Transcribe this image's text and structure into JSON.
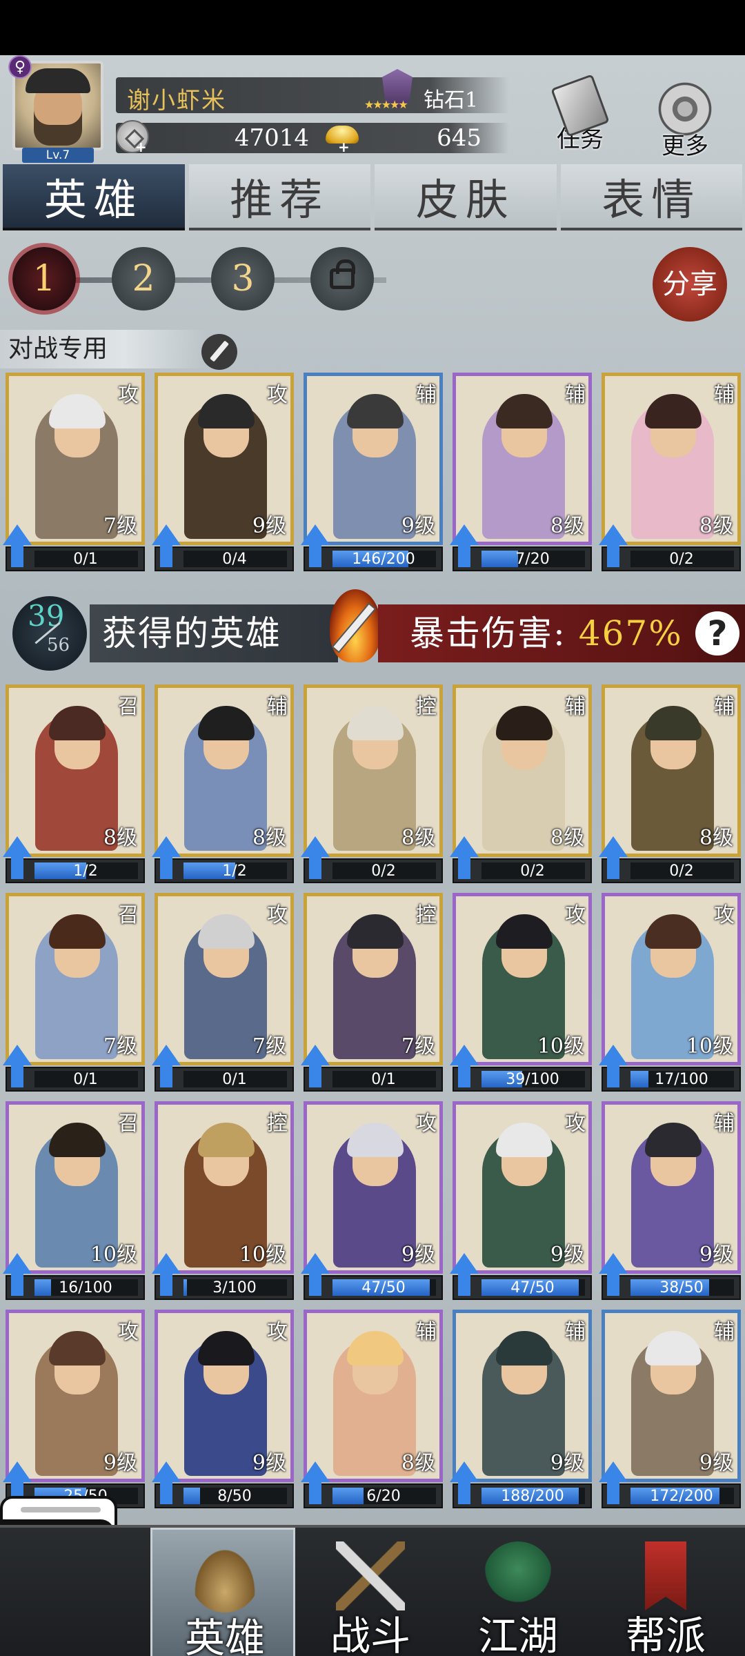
{
  "player": {
    "name": "谢小虾米",
    "level": "Lv.7",
    "gender": "♀",
    "rank": "钻石1",
    "silver": "47014",
    "gold": "645"
  },
  "top_buttons": {
    "task": "任务",
    "more": "更多"
  },
  "tabs": [
    "英雄",
    "推荐",
    "皮肤",
    "表情"
  ],
  "pages": [
    "1",
    "2",
    "3"
  ],
  "share": "分享",
  "lineup": {
    "label": "对战专用",
    "cards": [
      {
        "type": "攻",
        "level": "7级",
        "progress": "0/1",
        "fill": 0.0,
        "frame": "gold"
      },
      {
        "type": "攻",
        "level": "9级",
        "progress": "0/4",
        "fill": 0.0,
        "frame": "gold"
      },
      {
        "type": "辅",
        "level": "9级",
        "progress": "146/200",
        "fill": 0.73,
        "frame": "blue"
      },
      {
        "type": "辅",
        "level": "8级",
        "progress": "7/20",
        "fill": 0.35,
        "frame": "purple"
      },
      {
        "type": "辅",
        "level": "8级",
        "progress": "0/2",
        "fill": 0.0,
        "frame": "gold"
      }
    ]
  },
  "owned": {
    "count": "39",
    "total": "56",
    "label": "获得的英雄",
    "crit_label": "暴击伤害:",
    "crit_value": "467%",
    "help": "?"
  },
  "heroes": [
    [
      {
        "type": "召",
        "level": "8级",
        "progress": "1/2",
        "fill": 0.5,
        "frame": "gold"
      },
      {
        "type": "辅",
        "level": "8级",
        "progress": "1/2",
        "fill": 0.5,
        "frame": "gold"
      },
      {
        "type": "控",
        "level": "8级",
        "progress": "0/2",
        "fill": 0.0,
        "frame": "gold"
      },
      {
        "type": "辅",
        "level": "8级",
        "progress": "0/2",
        "fill": 0.0,
        "frame": "gold"
      },
      {
        "type": "辅",
        "level": "8级",
        "progress": "0/2",
        "fill": 0.0,
        "frame": "gold"
      }
    ],
    [
      {
        "type": "召",
        "level": "7级",
        "progress": "0/1",
        "fill": 0.0,
        "frame": "gold"
      },
      {
        "type": "攻",
        "level": "7级",
        "progress": "0/1",
        "fill": 0.0,
        "frame": "gold"
      },
      {
        "type": "控",
        "level": "7级",
        "progress": "0/1",
        "fill": 0.0,
        "frame": "gold"
      },
      {
        "type": "攻",
        "level": "10级",
        "progress": "39/100",
        "fill": 0.39,
        "frame": "purple"
      },
      {
        "type": "攻",
        "level": "10级",
        "progress": "17/100",
        "fill": 0.17,
        "frame": "purple"
      }
    ],
    [
      {
        "type": "召",
        "level": "10级",
        "progress": "16/100",
        "fill": 0.16,
        "frame": "purple"
      },
      {
        "type": "控",
        "level": "10级",
        "progress": "3/100",
        "fill": 0.03,
        "frame": "purple"
      },
      {
        "type": "攻",
        "level": "9级",
        "progress": "47/50",
        "fill": 0.94,
        "frame": "purple"
      },
      {
        "type": "攻",
        "level": "9级",
        "progress": "47/50",
        "fill": 0.94,
        "frame": "purple"
      },
      {
        "type": "辅",
        "level": "9级",
        "progress": "38/50",
        "fill": 0.76,
        "frame": "purple"
      }
    ],
    [
      {
        "type": "攻",
        "level": "9级",
        "progress": "25/50",
        "fill": 0.5,
        "frame": "purple"
      },
      {
        "type": "攻",
        "level": "9级",
        "progress": "8/50",
        "fill": 0.16,
        "frame": "purple"
      },
      {
        "type": "辅",
        "level": "8级",
        "progress": "6/20",
        "fill": 0.3,
        "frame": "purple"
      },
      {
        "type": "辅",
        "level": "9级",
        "progress": "188/200",
        "fill": 0.94,
        "frame": "blue"
      },
      {
        "type": "辅",
        "level": "9级",
        "progress": "172/200",
        "fill": 0.86,
        "frame": "blue"
      }
    ]
  ],
  "nav": [
    "英雄",
    "战斗",
    "江湖",
    "帮派"
  ],
  "colors": {
    "gold_frame": "#c9a23a",
    "blue_frame": "#4a7fc0",
    "purple_frame": "#9a66c8",
    "progress_fill": "#3a86e8",
    "crit_value": "#f5d040"
  }
}
